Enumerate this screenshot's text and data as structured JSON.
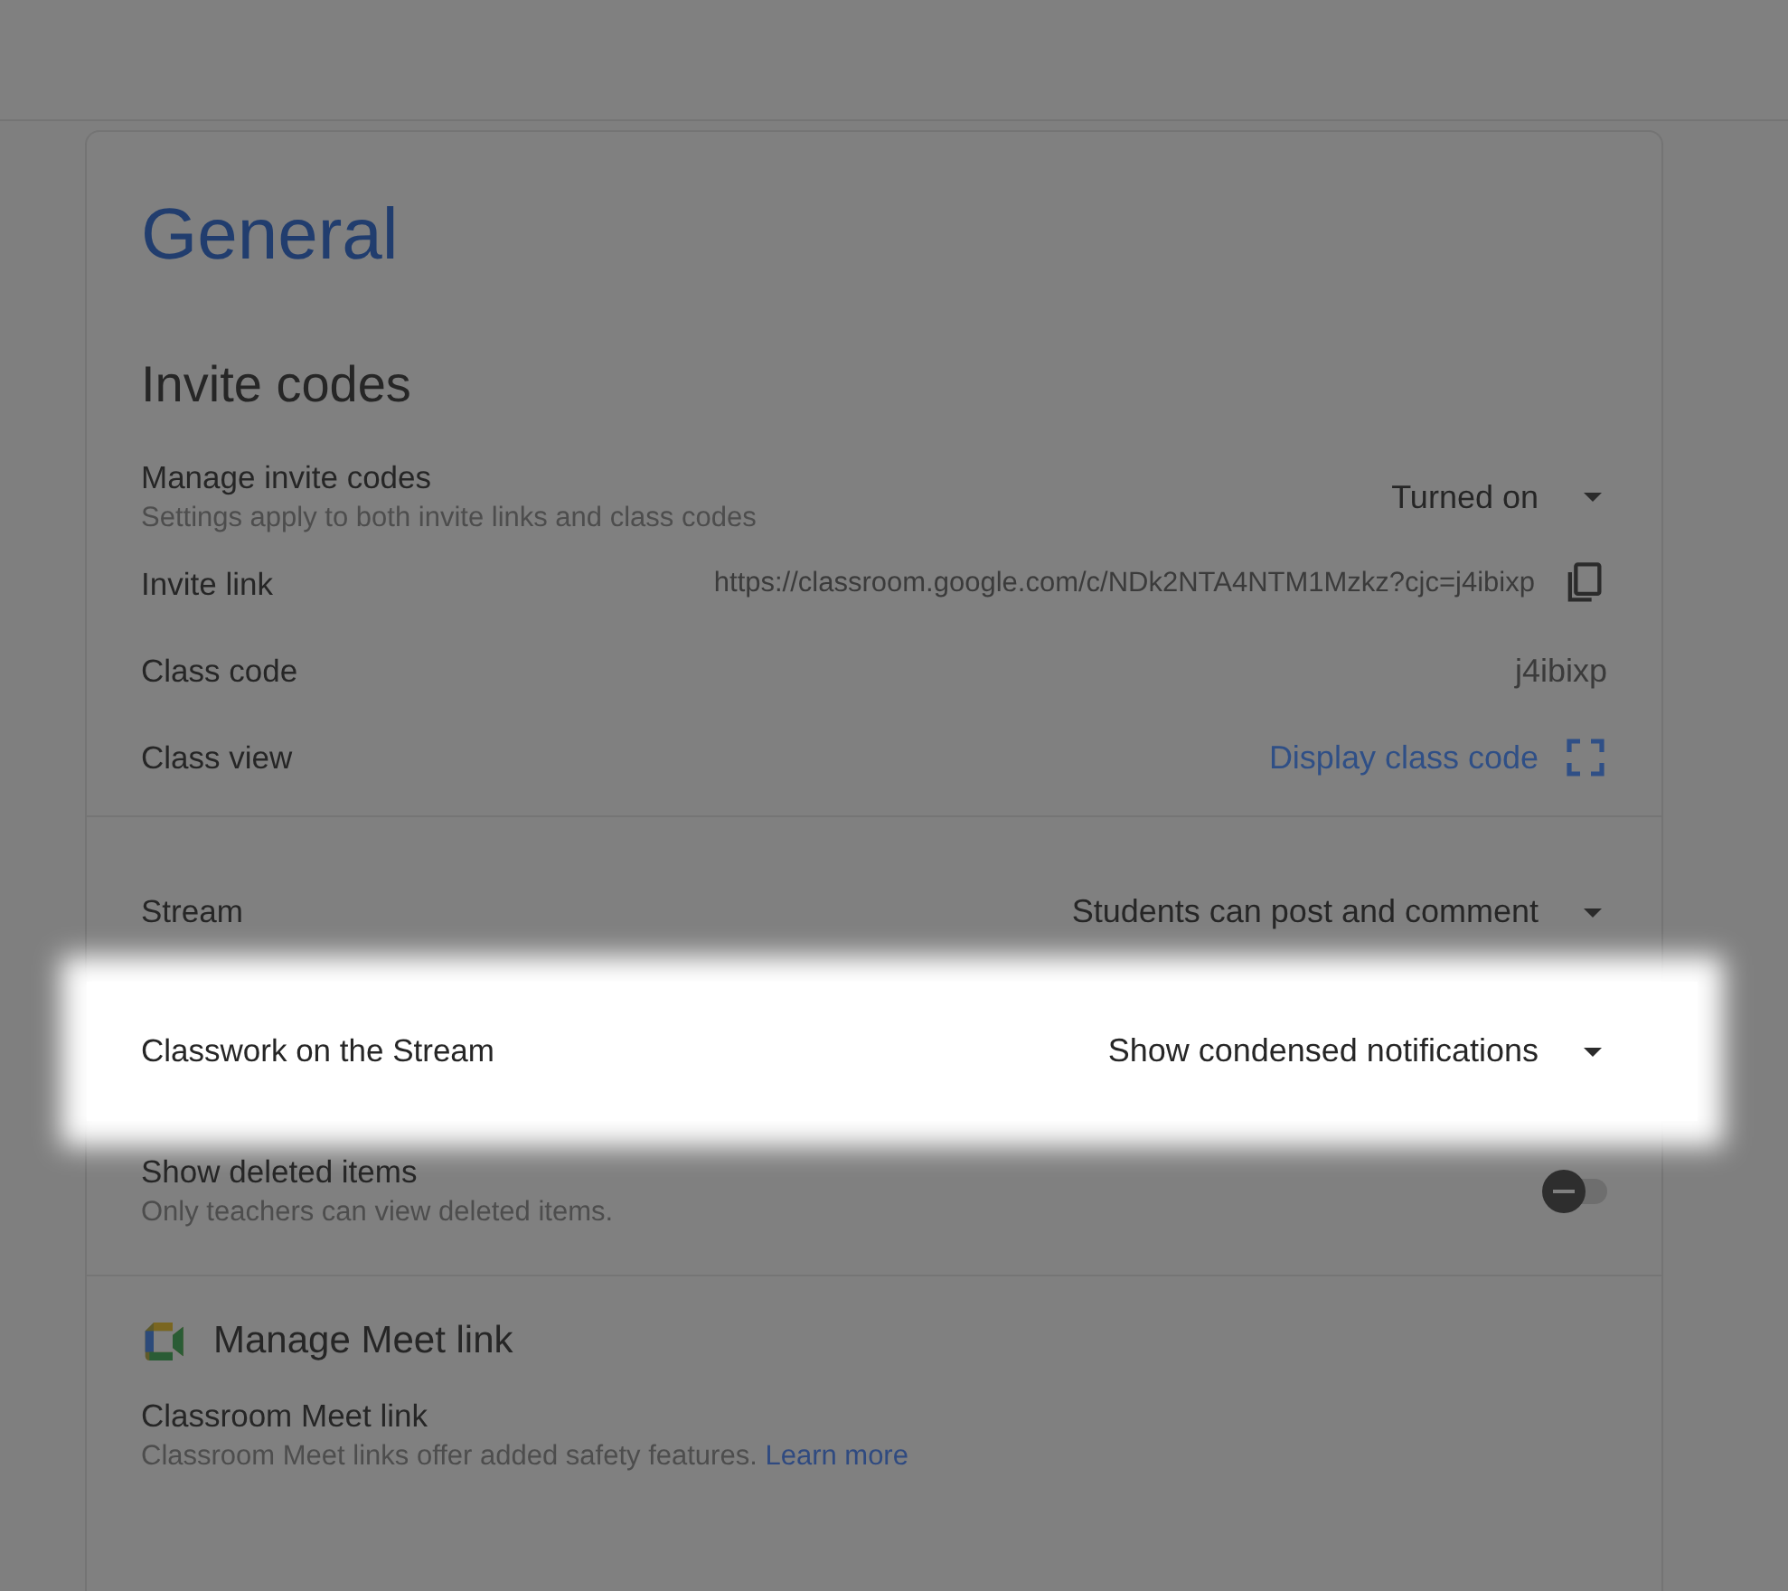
{
  "page_title": "General",
  "sections": [
    {
      "kind": "plain",
      "title": "Invite codes",
      "rows": [
        {
          "kind": "dropdown",
          "label": "Manage invite codes",
          "description": "Settings apply to both invite links and class codes",
          "value": "Turned on",
          "highlighted": false
        },
        {
          "kind": "copy",
          "label": "Invite link",
          "value": "https://classroom.google.com/c/NDk2NTA4NTM1Mzkz?cjc=j4ibixp",
          "highlighted": false
        },
        {
          "kind": "text",
          "label": "Class code",
          "value": "j4ibixp",
          "highlighted": false
        },
        {
          "kind": "action",
          "label": "Class view",
          "value": "Display class code",
          "highlighted": false
        }
      ]
    },
    {
      "kind": "plain",
      "rows": [
        {
          "kind": "dropdown",
          "label": "Stream",
          "value": "Students can post and comment",
          "highlighted": false
        },
        {
          "kind": "dropdown",
          "label": "Classwork on the Stream",
          "value": "Show condensed notifications",
          "highlighted": true
        },
        {
          "kind": "toggle",
          "label": "Show deleted items",
          "description": "Only teachers can view deleted items.",
          "on": false,
          "highlighted": false
        }
      ]
    },
    {
      "kind": "meet",
      "title": "Manage Meet link",
      "rows": [
        {
          "kind": "info",
          "label": "Classroom Meet link",
          "description": "Classroom Meet links offer added safety features.",
          "link": "Learn more",
          "highlighted": false
        }
      ]
    }
  ]
}
